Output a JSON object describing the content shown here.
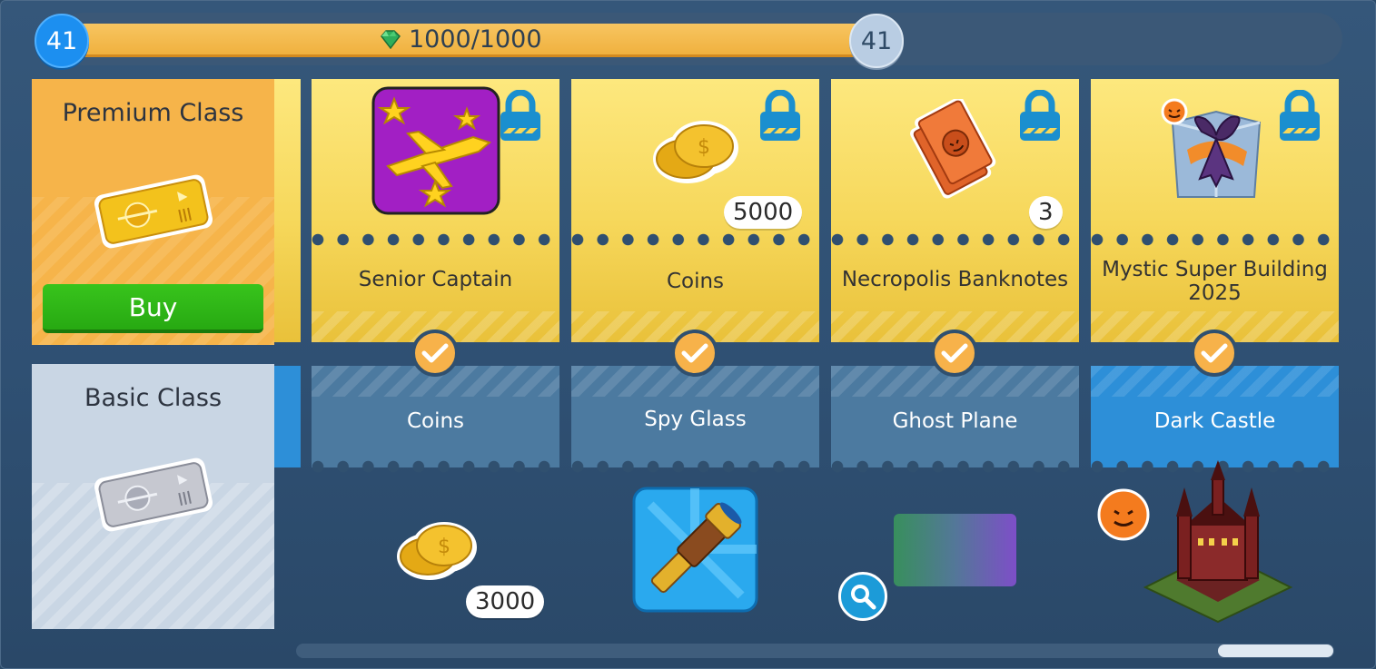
{
  "progress": {
    "level_current": "41",
    "level_next": "41",
    "value_text": "1000/1000",
    "fill_fraction": 1.0,
    "icon": "gem-icon"
  },
  "classes": {
    "premium": {
      "title": "Premium Class",
      "buy_label": "Buy",
      "icon": "gold-ticket-icon"
    },
    "basic": {
      "title": "Basic Class",
      "icon": "silver-ticket-icon"
    }
  },
  "columns": [
    {
      "premium": {
        "label": "Senior Captain",
        "icon": "plane-avatar-icon",
        "locked": true,
        "badge": ""
      },
      "basic": {
        "label": "Coins",
        "icon": "coins-icon",
        "badge": "3000",
        "active": false
      }
    },
    {
      "premium": {
        "label": "Coins",
        "icon": "coins-icon",
        "locked": true,
        "badge": "5000"
      },
      "basic": {
        "label": "Spy Glass",
        "icon": "spyglass-icon",
        "badge": "",
        "active": false
      }
    },
    {
      "premium": {
        "label": "Necropolis Banknotes",
        "icon": "banknotes-icon",
        "locked": true,
        "badge": "3"
      },
      "basic": {
        "label": "Ghost Plane",
        "icon": "ghost-plane-icon",
        "badge": "",
        "active": false
      }
    },
    {
      "premium": {
        "label": "Mystic Super Building 2025",
        "icon": "gift-building-icon",
        "locked": true,
        "badge": ""
      },
      "basic": {
        "label": "Dark Castle",
        "icon": "dark-castle-icon",
        "badge": "",
        "active": true
      }
    }
  ],
  "colors": {
    "premium_orange": "#f6b44a",
    "premium_yellow": "#f6d75a",
    "basic_blue": "#4c7aa0",
    "active_blue": "#2d8fd8",
    "buy_green": "#2bb014",
    "lock_teal": "#1b8fcf"
  }
}
